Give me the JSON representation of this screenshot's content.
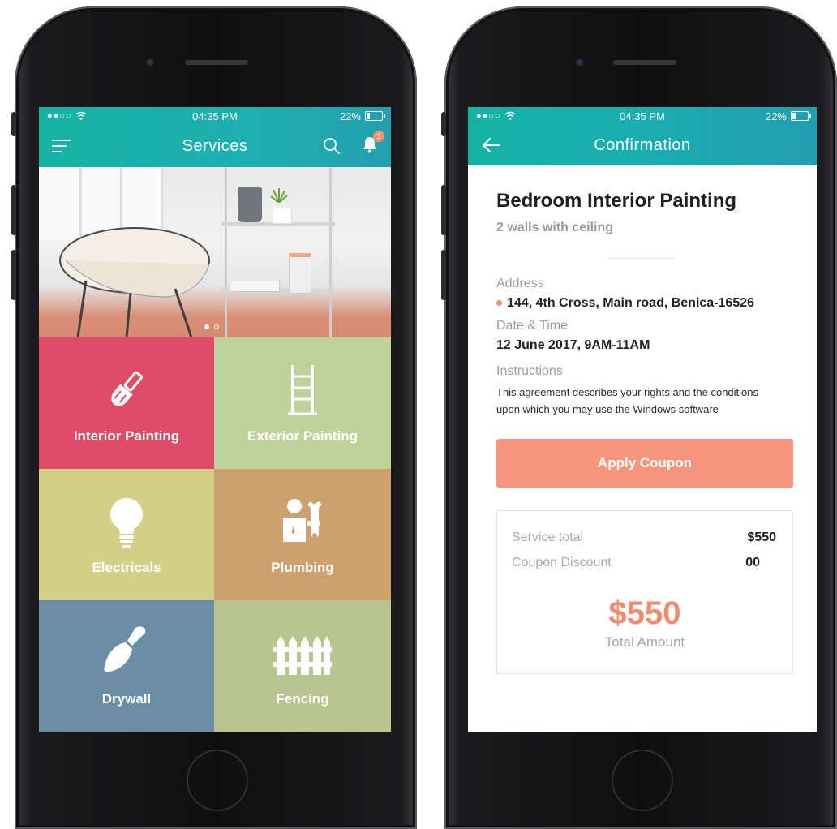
{
  "status": {
    "time": "04:35 PM",
    "battery": "22%"
  },
  "services_screen": {
    "title": "Services",
    "notification_count": "1",
    "tiles": [
      {
        "label": "Interior Painting",
        "color": "#df4c69",
        "icon": "paintbrush-icon"
      },
      {
        "label": "Exterior Painting",
        "color": "#bfd29c",
        "icon": "ladder-icon"
      },
      {
        "label": "Electricals",
        "color": "#d4cf88",
        "icon": "lightbulb-icon"
      },
      {
        "label": "Plumbing",
        "color": "#cda06e",
        "icon": "plumber-icon"
      },
      {
        "label": "Drywall",
        "color": "#6a8ea3",
        "icon": "trowel-icon"
      },
      {
        "label": "Fencing",
        "color": "#b9c48f",
        "icon": "fence-icon"
      }
    ]
  },
  "confirmation_screen": {
    "title": "Confirmation",
    "job_title": "Bedroom Interior Painting",
    "job_subtitle": "2 walls with ceiling",
    "address_label": "Address",
    "address_value": "144, 4th Cross, Main road, Benica-16526",
    "datetime_label": "Date & Time",
    "datetime_value": "12 June 2017, 9AM-11AM",
    "instructions_label": "Instructions",
    "instructions_line1": "This agreement describes your rights and the conditions",
    "instructions_line2": "upon which you may use the Windows software",
    "coupon_button": "Apply Coupon",
    "service_total_label": "Service total",
    "service_total_value": "$550",
    "coupon_discount_label": "Coupon Discount",
    "coupon_discount_value": "00",
    "total_amount_value": "$550",
    "total_amount_label": "Total Amount"
  },
  "colors": {
    "teal": "#19b1a8",
    "accent": "#f5957e"
  }
}
